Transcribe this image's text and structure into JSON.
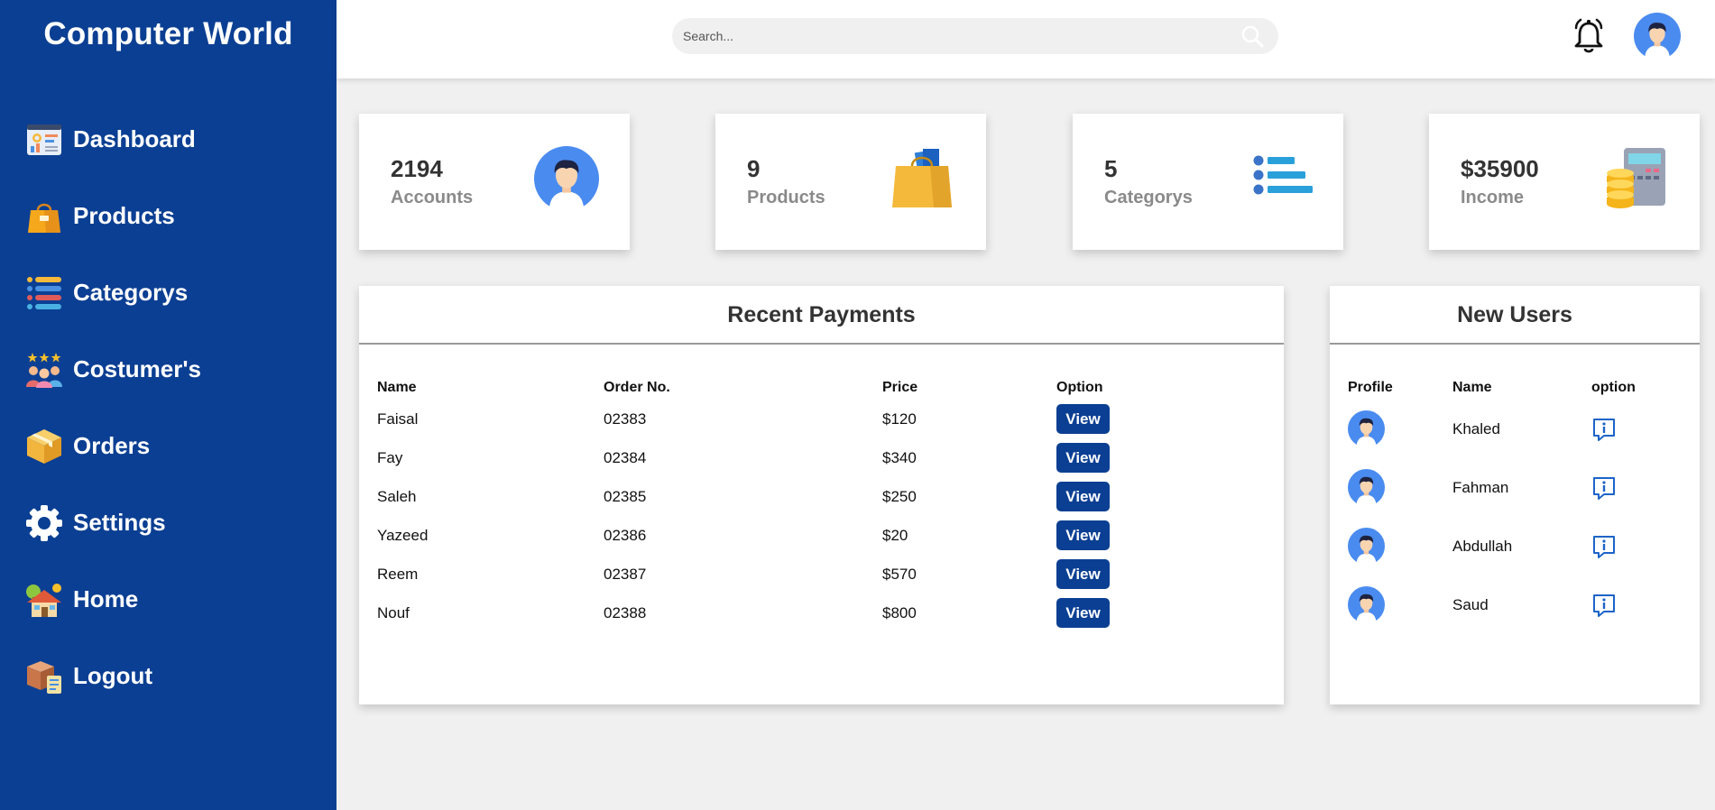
{
  "sidebar": {
    "brand": "Computer World",
    "items": [
      {
        "label": "Dashboard",
        "icon": "dashboard-icon"
      },
      {
        "label": "Products",
        "icon": "shopping-bag-icon"
      },
      {
        "label": "Categorys",
        "icon": "list-icon"
      },
      {
        "label": "Costumer's",
        "icon": "customers-icon"
      },
      {
        "label": "Orders",
        "icon": "box-icon"
      },
      {
        "label": "Settings",
        "icon": "gear-icon"
      },
      {
        "label": "Home",
        "icon": "house-icon"
      },
      {
        "label": "Logout",
        "icon": "logout-box-icon"
      }
    ]
  },
  "topbar": {
    "search_placeholder": "Search...",
    "icons": [
      "search-icon",
      "bell-icon",
      "user-avatar"
    ]
  },
  "cards": [
    {
      "value": "2194",
      "label": "Accounts",
      "icon": "user-avatar-icon"
    },
    {
      "value": "9",
      "label": "Products",
      "icon": "shopping-bag-icon"
    },
    {
      "value": "5",
      "label": "Categorys",
      "icon": "list-icon"
    },
    {
      "value": "$35900",
      "label": "Income",
      "icon": "calculator-coins-icon"
    }
  ],
  "payments": {
    "title": "Recent Payments",
    "headers": [
      "Name",
      "Order No.",
      "Price",
      "Option"
    ],
    "rows": [
      {
        "name": "Faisal",
        "order": "02383",
        "price": "$120",
        "action": "View"
      },
      {
        "name": "Fay",
        "order": "02384",
        "price": "$340",
        "action": "View"
      },
      {
        "name": "Saleh",
        "order": "02385",
        "price": "$250",
        "action": "View"
      },
      {
        "name": "Yazeed",
        "order": "02386",
        "price": "$20",
        "action": "View"
      },
      {
        "name": "Reem",
        "order": "02387",
        "price": "$570",
        "action": "View"
      },
      {
        "name": "Nouf",
        "order": "02388",
        "price": "$800",
        "action": "View"
      }
    ]
  },
  "new_users": {
    "title": "New Users",
    "headers": [
      "Profile",
      "Name",
      "option"
    ],
    "rows": [
      {
        "name": "Khaled"
      },
      {
        "name": "Fahman"
      },
      {
        "name": "Abdullah"
      },
      {
        "name": "Saud"
      }
    ]
  },
  "colors": {
    "sidebar": "#0b3f93",
    "accent": "#0b3f93",
    "background": "#f0f0f0",
    "avatar": "#4a8bf0"
  }
}
